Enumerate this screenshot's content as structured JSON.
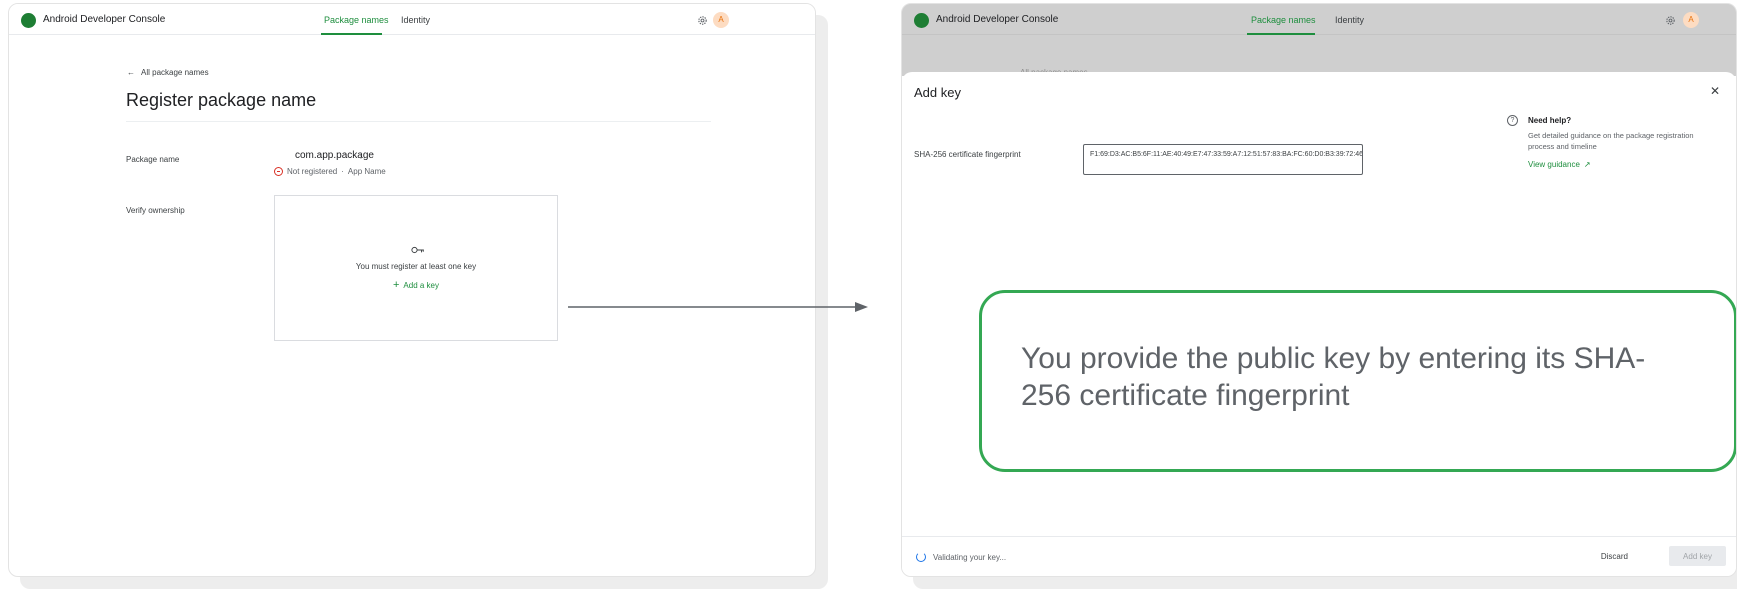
{
  "left_window": {
    "app_title": "Android Developer Console",
    "tabs": [
      {
        "label": "Package names",
        "active": true
      },
      {
        "label": "Identity",
        "active": false
      }
    ],
    "avatar_letter": "A",
    "back_link": "All package names",
    "page_title": "Register package name",
    "package_name_label": "Package name",
    "package_value": "com.app.package",
    "status": "Not registered",
    "status_separator": "·",
    "app_name": "App Name",
    "verify_label": "Verify ownership",
    "key_message": "You must register at least one key",
    "add_key_link": "Add a key"
  },
  "right_window": {
    "app_title": "Android Developer Console",
    "tabs": [
      {
        "label": "Package names",
        "active": true
      },
      {
        "label": "Identity",
        "active": false
      }
    ],
    "avatar_letter": "A",
    "ghost_back_link": "All package names",
    "dialog": {
      "title": "Add key",
      "field_label": "SHA-256 certificate fingerprint",
      "fingerprint_value": "F1:69:D3:AC:B5:6F:11:AE:40:49:E7:47:33:59:A7:12:51:57:83:BA:FC:60:D0:B3:39:72:46:B9:96:24:B6:25",
      "help_title": "Need help?",
      "help_description": "Get detailed guidance on the package registration process and timeline",
      "help_link": "View guidance",
      "validating_text": "Validating your key...",
      "discard_label": "Discard",
      "add_key_label": "Add key"
    },
    "callout_text": "You provide the public key by entering its SHA-256 certificate fingerprint"
  },
  "icons": {
    "back": "arrow-left-icon",
    "settings": "gear-icon",
    "key": "key-icon",
    "add": "plus-icon",
    "close": "close-icon",
    "help": "help-icon",
    "external": "external-link-icon",
    "loading": "spinner-icon"
  },
  "colors": {
    "brand_green": "#1e8e3e",
    "callout_border": "#34a853",
    "error_red": "#d93025",
    "avatar_bg": "#fddcc2"
  }
}
